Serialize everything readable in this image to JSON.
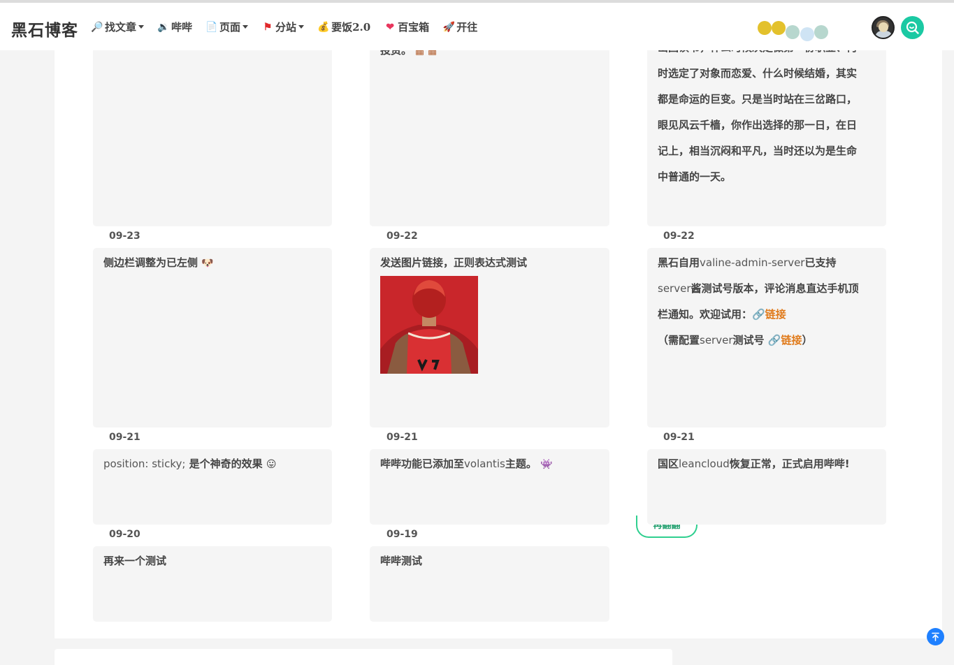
{
  "nav": {
    "brand": "黑石博客",
    "items": [
      {
        "label": "找文章",
        "icon": "magnifier-icon",
        "dropdown": true
      },
      {
        "label": "哔哔",
        "icon": "speaker-icon",
        "dropdown": false
      },
      {
        "label": "页面",
        "icon": "page-icon",
        "dropdown": true
      },
      {
        "label": "分站",
        "icon": "flag-icon",
        "dropdown": true
      },
      {
        "label": "要饭2.0",
        "icon": "money-bag-icon",
        "dropdown": false
      },
      {
        "label": "百宝箱",
        "icon": "heart-icon",
        "dropdown": false
      },
      {
        "label": "开往",
        "icon": "rocket-icon",
        "dropdown": false
      }
    ],
    "dot_colors": [
      "#e3c12c",
      "#e3c12c",
      "#b7d7ce",
      "#cfe4f4",
      "#b7d7ce"
    ],
    "accent": "#1bc9a3"
  },
  "posts": {
    "r1c1_date": "09-23",
    "r1c2_text": "投资。",
    "r1c2_date": "09-22",
    "r1c3_line0": "出国读书，什么时候决定做第一份职业、何",
    "r1c3_line1": "时选定了对象而恋爱、什么时候结婚，其实",
    "r1c3_line2": "都是命运的巨变。只是当时站在三岔路口，",
    "r1c3_line3": "眼见风云千樯，你作出选择的那一日，在日",
    "r1c3_line4": "记上，相当沉闷和平凡，当时还以为是生命",
    "r1c3_line5": "中普通的一天。",
    "r1c3_date": "09-22",
    "r2c1_text": "侧边栏调整为已左侧",
    "r2c1_date": "09-21",
    "r2c2_text": "发送图片链接，正则表达式测试",
    "r2c2_date": "09-21",
    "r2c3_a": "黑石自用",
    "r2c3_b": "valine-admin-server",
    "r2c3_c": "已支持",
    "r2c3_d": "server",
    "r2c3_e": "酱测试号版本，评论消息直达手机顶",
    "r2c3_f": "栏通知。欢迎试用：",
    "r2c3_link1": "链接",
    "r2c3_g": "（需配置",
    "r2c3_h": "server",
    "r2c3_i": "测试号",
    "r2c3_link2": "链接",
    "r2c3_j": "）",
    "r2c3_date": "09-21",
    "r3c1_a": "position: sticky;",
    "r3c1_b": " 是个神奇的效果",
    "r3c1_date": "09-20",
    "r3c2_a": "哔哔功能已添加至",
    "r3c2_b": "volantis",
    "r3c2_c": "主题。",
    "r3c2_date": "09-19",
    "r3c3_a": "国区",
    "r3c3_b": "leancloud",
    "r3c3_c": "恢复正常，正式启用哔哔!",
    "r4c1_text": "再来一个测试",
    "r4c2_text": "哔哔测试"
  },
  "more_button": "再翻翻"
}
